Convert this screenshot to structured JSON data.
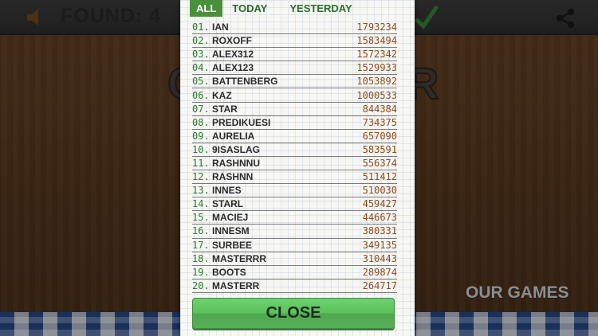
{
  "hud": {
    "found_label": "FOUND:  4",
    "sound_icon": "speaker-icon",
    "share_icon": "share-icon",
    "check_icon": "check-icon"
  },
  "background": {
    "title_left": "C",
    "title_right": "R",
    "our_games_label": "OUR GAMES"
  },
  "leaderboard": {
    "tabs": [
      {
        "label": "ALL",
        "active": true
      },
      {
        "label": "TODAY",
        "active": false
      },
      {
        "label": "YESTERDAY",
        "active": false
      }
    ],
    "entries": [
      {
        "rank": "01.",
        "name": "IAN",
        "score": "1793234"
      },
      {
        "rank": "02.",
        "name": "ROXOFF",
        "score": "1583494"
      },
      {
        "rank": "03.",
        "name": "ALEX312",
        "score": "1572342"
      },
      {
        "rank": "04.",
        "name": "ALEX123",
        "score": "1529933"
      },
      {
        "rank": "05.",
        "name": "BATTENBERG",
        "score": "1053892"
      },
      {
        "rank": "06.",
        "name": "KAZ",
        "score": "1000533"
      },
      {
        "rank": "07.",
        "name": "STAR",
        "score": "844384"
      },
      {
        "rank": "08.",
        "name": "PREDIKUESI",
        "score": "734375"
      },
      {
        "rank": "09.",
        "name": "AURELIA",
        "score": "657090"
      },
      {
        "rank": "10.",
        "name": "9ISASLAG",
        "score": "583591"
      },
      {
        "rank": "11.",
        "name": "RASHNNU",
        "score": "556374"
      },
      {
        "rank": "12.",
        "name": "RASHNN",
        "score": "511412"
      },
      {
        "rank": "13.",
        "name": "INNES",
        "score": "510030"
      },
      {
        "rank": "14.",
        "name": "STARL",
        "score": "459427"
      },
      {
        "rank": "15.",
        "name": "MACIEJ",
        "score": "446673"
      },
      {
        "rank": "16.",
        "name": "INNESM",
        "score": "380331"
      },
      {
        "rank": "17.",
        "name": "SURBEE",
        "score": "349135"
      },
      {
        "rank": "18.",
        "name": "MASTERRR",
        "score": "310443"
      },
      {
        "rank": "19.",
        "name": "BOOTS",
        "score": "289874"
      },
      {
        "rank": "20.",
        "name": "MASTERR",
        "score": "264717"
      }
    ],
    "close_label": "CLOSE"
  },
  "colors": {
    "accent_green": "#4a8f3c",
    "rank_green": "#2e7a2e",
    "score_brown": "#8a4b1c",
    "close_button": "#5cc25c"
  }
}
